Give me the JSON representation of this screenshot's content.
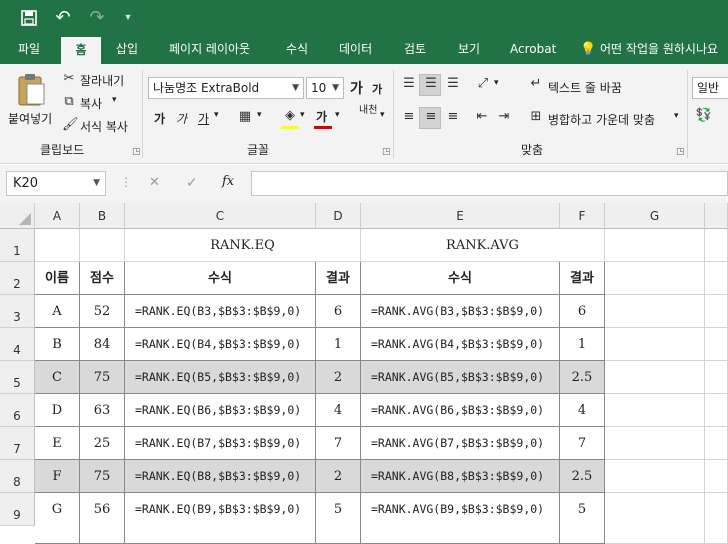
{
  "titlebar": {
    "save_icon": "💾",
    "undo_icon": "↶",
    "redo_icon": "↷",
    "qa_icon": "▾"
  },
  "tabs": [
    "파일",
    "홈",
    "삽입",
    "페이지 레이아웃",
    "수식",
    "데이터",
    "검토",
    "보기",
    "Acrobat",
    "어떤 작업을 원하시나요"
  ],
  "active_tab": "홈",
  "ribbon": {
    "clipboard": {
      "paste": "붙여넣기",
      "cut": "잘라내기",
      "copy": "복사",
      "format_painter": "서식 복사",
      "label": "클립보드"
    },
    "font": {
      "name": "나눔명조 ExtraBold",
      "size": "10",
      "label": "글꼴",
      "grow": "가",
      "shrink": "가",
      "bold": "가",
      "italic": "가",
      "underline": "가",
      "fontcolor": "가",
      "phonetic": "내천"
    },
    "alignment": {
      "wrap_text": "텍스트 줄 바꿈",
      "merge_center": "병합하고 가운데 맞춤",
      "label": "맞춤"
    },
    "number": {
      "format": "일반"
    }
  },
  "formula_bar": {
    "name_box": "K20",
    "cancel": "✕",
    "enter": "✓",
    "fx": "fx",
    "value": ""
  },
  "accent": "#217346",
  "columns": [
    "A",
    "B",
    "C",
    "D",
    "E",
    "F",
    "G"
  ],
  "rows": [
    "1",
    "2",
    "3",
    "4",
    "5",
    "6",
    "7",
    "8",
    "9"
  ],
  "table": {
    "eq_title": "RANK.EQ",
    "avg_title": "RANK.AVG",
    "headers": {
      "name": "이름",
      "score": "점수",
      "formula": "수식",
      "result": "결과"
    },
    "data": [
      {
        "name": "A",
        "score": "52",
        "eq": "=RANK.EQ(B3,$B$3:$B$9,0)",
        "eq_res": "6",
        "avg": "=RANK.AVG(B3,$B$3:$B$9,0)",
        "avg_res": "6",
        "shaded": false
      },
      {
        "name": "B",
        "score": "84",
        "eq": "=RANK.EQ(B4,$B$3:$B$9,0)",
        "eq_res": "1",
        "avg": "=RANK.AVG(B4,$B$3:$B$9,0)",
        "avg_res": "1",
        "shaded": false
      },
      {
        "name": "C",
        "score": "75",
        "eq": "=RANK.EQ(B5,$B$3:$B$9,0)",
        "eq_res": "2",
        "avg": "=RANK.AVG(B5,$B$3:$B$9,0)",
        "avg_res": "2.5",
        "shaded": true
      },
      {
        "name": "D",
        "score": "63",
        "eq": "=RANK.EQ(B6,$B$3:$B$9,0)",
        "eq_res": "4",
        "avg": "=RANK.AVG(B6,$B$3:$B$9,0)",
        "avg_res": "4",
        "shaded": false
      },
      {
        "name": "E",
        "score": "25",
        "eq": "=RANK.EQ(B7,$B$3:$B$9,0)",
        "eq_res": "7",
        "avg": "=RANK.AVG(B7,$B$3:$B$9,0)",
        "avg_res": "7",
        "shaded": false
      },
      {
        "name": "F",
        "score": "75",
        "eq": "=RANK.EQ(B8,$B$3:$B$9,0)",
        "eq_res": "2",
        "avg": "=RANK.AVG(B8,$B$3:$B$9,0)",
        "avg_res": "2.5",
        "shaded": true
      },
      {
        "name": "G",
        "score": "56",
        "eq": "=RANK.EQ(B9,$B$3:$B$9,0)",
        "eq_res": "5",
        "avg": "=RANK.AVG(B9,$B$3:$B$9,0)",
        "avg_res": "5",
        "shaded": false
      }
    ]
  }
}
